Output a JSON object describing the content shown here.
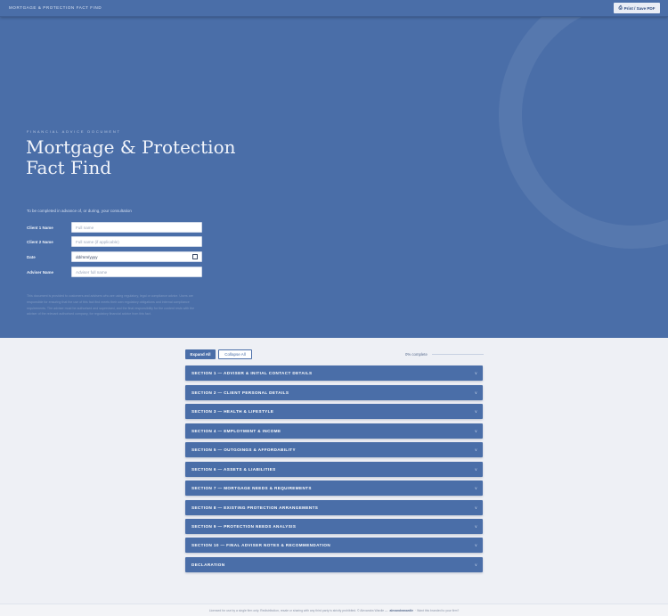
{
  "topbar": {
    "title": "MORTGAGE & PROTECTION FACT FIND",
    "print_label": "Print / Save PDF",
    "print_icon": "printer-icon"
  },
  "hero": {
    "eyebrow": "FINANCIAL ADVICE DOCUMENT",
    "title_line1": "Mortgage & Protection",
    "title_line2": "Fact Find",
    "intro": "To be completed in advance of, or during, your consultation",
    "fields": [
      {
        "label": "Client 1 Name",
        "placeholder": "Full name"
      },
      {
        "label": "Client 2 Name",
        "placeholder": "Full name (if applicable)"
      },
      {
        "label": "Date",
        "value": "dd/mm/yyyy"
      },
      {
        "label": "Adviser Name",
        "placeholder": "Adviser full name"
      }
    ],
    "disclaimer": "This document is provided to customers and advisers who are using regulatory, legal or compliance advice. Users are responsible for ensuring that the use of this fact find meets their own regulatory obligations and internal compliance requirements. The adviser must be authorised and supervised, and the final responsibility for the content rests with the adviser of the relevant authorised company, for regulatory financial advice from this fact."
  },
  "controls": {
    "expand_label": "Expand All",
    "collapse_label": "Collapse All",
    "progress_text": "0% complete",
    "progress_fraction": 0
  },
  "sections": [
    "SECTION 1 — ADVISER & INITIAL CONTACT DETAILS",
    "SECTION 2 — CLIENT PERSONAL DETAILS",
    "SECTION 3 — HEALTH & LIFESTYLE",
    "SECTION 4 — EMPLOYMENT & INCOME",
    "SECTION 5 — OUTGOINGS & AFFORDABILITY",
    "SECTION 6 — ASSETS & LIABILITIES",
    "SECTION 7 — MORTGAGE NEEDS & REQUIREMENTS",
    "SECTION 8 — EXISTING PROTECTION ARRANGEMENTS",
    "SECTION 9 — PROTECTION NEEDS ANALYSIS",
    "SECTION 10 — FINAL ADVISER NOTES & RECOMMENDATION",
    "DECLARATION"
  ],
  "footer": {
    "text": "Licensed for use by a single firm only. Redistribution, resale or sharing with any third party is strictly prohibited. © Alexandra Wardle —",
    "link": "alexandrawardle",
    "tail": "· Want this branded to your firm?"
  },
  "colors": {
    "brand": "#4a6ea8",
    "page_bg": "#eef0f5"
  }
}
